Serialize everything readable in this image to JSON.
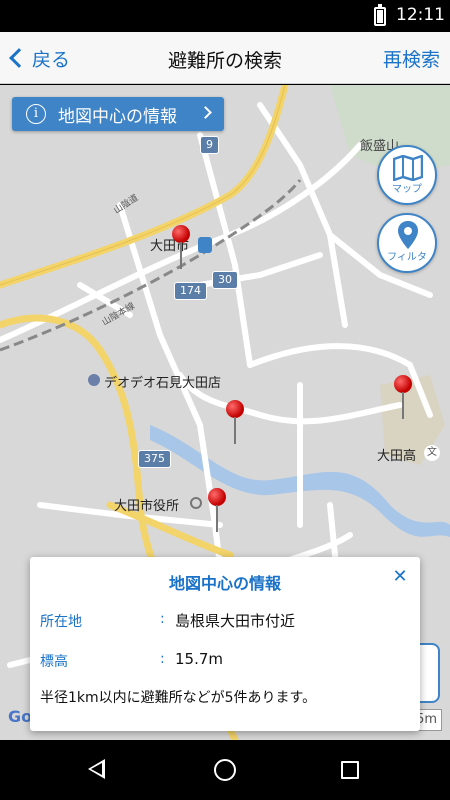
{
  "status_bar": {
    "time": "12:11"
  },
  "nav": {
    "back_label": "戻る",
    "title": "避難所の検索",
    "research_label": "再検索"
  },
  "map": {
    "info_button_label": "地図中心の情報",
    "map_button_label": "マップ",
    "filter_button_label": "フィルタ",
    "labels": {
      "mountain": "飯盛山",
      "sanin_road": "山陰道",
      "sanin_line": "山陰本線",
      "station": "大田市",
      "store": "デオデオ石見大田店",
      "school": "大田高",
      "school_mark": "文",
      "city_hall": "大田市役所",
      "google": "Google",
      "scale": "5m"
    },
    "route_shields": [
      "9",
      "30",
      "174",
      "375"
    ],
    "accent_color": "#3f84c7",
    "pin_color": "#d00000"
  },
  "dialog": {
    "title": "地図中心の情報",
    "close_icon": "close-icon",
    "location_label": "所在地",
    "location_value": "島根県大田市付近",
    "elevation_label": "標高",
    "elevation_value": "15.7m",
    "colon": ":",
    "note": "半径1km以内に避難所などが5件あります。"
  }
}
